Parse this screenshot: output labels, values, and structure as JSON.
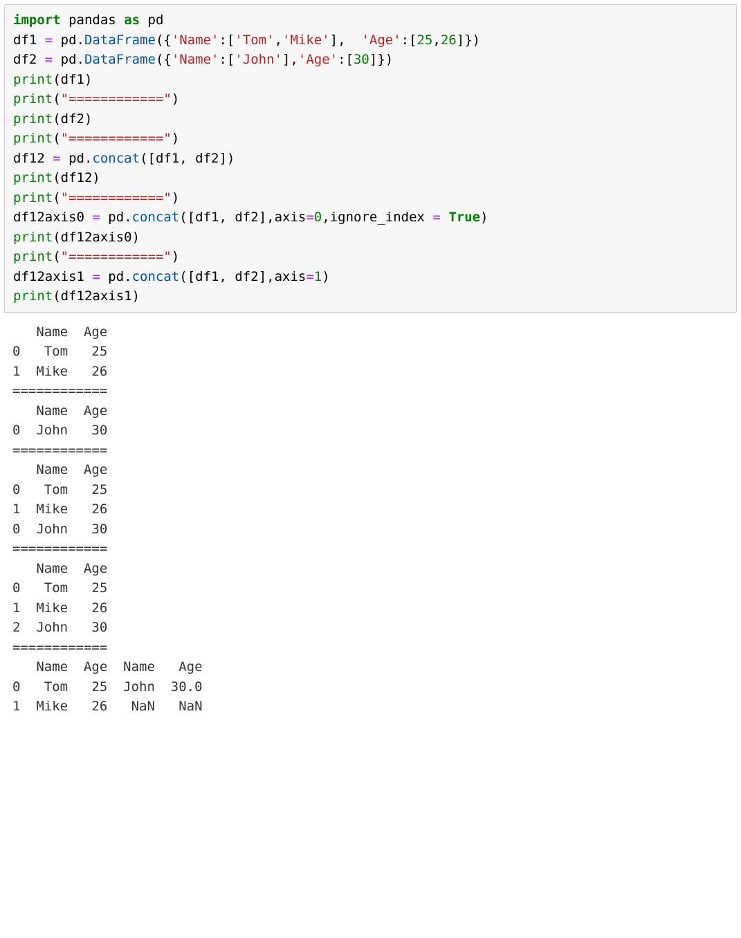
{
  "code": {
    "import_kw": "import",
    "pandas": "pandas",
    "as_kw": "as",
    "pd": "pd",
    "df1_assign": "df1 ",
    "df2_assign": "df2 ",
    "df12_assign": "df12 ",
    "df12axis0_assign": "df12axis0 ",
    "df12axis1_assign": "df12axis1 ",
    "eq": "=",
    "pd_dot": " pd.",
    "DataFrame": "DataFrame",
    "concat": "concat",
    "print_fn": "print",
    "name_key": "'Name'",
    "age_key": "'Age'",
    "tom": "'Tom'",
    "mike": "'Mike'",
    "john": "'John'",
    "n25": "25",
    "n26": "26",
    "n30": "30",
    "n0": "0",
    "n1": "1",
    "sep_str": "\"============\"",
    "axis_kw": "axis",
    "ignore_index_kw": "ignore_index ",
    "true_kw": "True",
    "df1_var": "df1",
    "df2_var": "df2",
    "df12_var": "df12",
    "df12axis0_var": "df12axis0",
    "df12axis1_var": "df12axis1",
    "open_curly_str": "({",
    "close_curly_str": "})",
    "colon_br": ":[",
    "close_br": "]",
    "comma": ",",
    "comma_sp": ", ",
    "open_paren": "(",
    "close_paren": ")",
    "open_br_list": "([",
    "close_br_list": "])",
    "close_br_comma": "],",
    "spacer": "  "
  },
  "output": {
    "block": "   Name  Age\n0   Tom   25\n1  Mike   26\n============\n   Name  Age\n0  John   30\n============\n   Name  Age\n0   Tom   25\n1  Mike   26\n0  John   30\n============\n   Name  Age\n0   Tom   25\n1  Mike   26\n2  John   30\n============\n   Name  Age  Name   Age\n0   Tom   25  John  30.0\n1  Mike   26   NaN   NaN"
  }
}
